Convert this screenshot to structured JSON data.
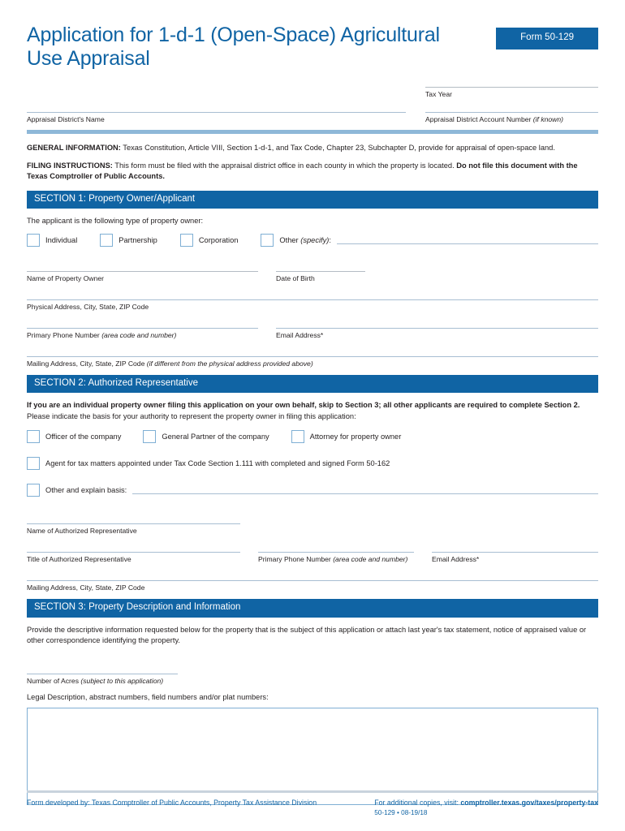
{
  "header": {
    "title": "Application for 1-d-1 (Open-Space) Agricultural Use Appraisal",
    "form_badge": "Form 50-129"
  },
  "top_fields": {
    "tax_year_label": "Tax Year",
    "appraisal_district_name_label": "Appraisal District's Name",
    "account_number_label": "Appraisal District Account Number ",
    "account_number_label_italic": "(if known)"
  },
  "intro": {
    "general_label": "GENERAL INFORMATION:",
    "general_text": " Texas Constitution, Article VIII, Section 1-d-1, and Tax Code, Chapter 23, Subchapter D, provide for appraisal of open-space land.",
    "filing_label": "FILING INSTRUCTIONS:",
    "filing_text": " This form must be filed with the appraisal district office in each county in which the property is located. ",
    "filing_bold_tail": "Do not file this document with the Texas Comptroller of Public Accounts."
  },
  "section1": {
    "bar": "SECTION 1: Property Owner/Applicant",
    "prompt": "The applicant is the following type of property owner:",
    "owner_types": [
      {
        "label": "Individual"
      },
      {
        "label": "Partnership"
      },
      {
        "label": "Corporation"
      }
    ],
    "other_label": "Other ",
    "other_label_italic": "(specify)",
    "other_label_tail": ":",
    "name_of_owner_label": "Name of Property Owner",
    "date_of_birth_label": "Date of Birth",
    "physical_address_label": "Physical Address, City, State, ZIP Code",
    "primary_phone_label": "Primary Phone Number ",
    "primary_phone_label_italic": "(area code and number)",
    "email_label": "Email Address*",
    "mailing_address_label": "Mailing Address, City, State, ZIP Code ",
    "mailing_address_label_italic": "(if different from the physical address provided above)"
  },
  "section2": {
    "bar": "SECTION 2: Authorized Representative",
    "bold_intro": "If you are an individual property owner filing this application on your own behalf, skip to Section 3; all other applicants are required to complete Section 2.",
    "sub_intro": "Please indicate the basis for your authority to represent the property owner in filing this application:",
    "basis_options": [
      {
        "label": "Officer of the company"
      },
      {
        "label": "General Partner of the company"
      },
      {
        "label": "Attorney for property owner"
      }
    ],
    "agent_option": "Agent for tax matters appointed under Tax Code Section 1.111 with completed and signed Form 50-162",
    "other_option": "Other and explain basis:",
    "name_label": "Name of Authorized Representative",
    "title_label": "Title of Authorized Representative",
    "primary_phone_label": "Primary Phone Number ",
    "primary_phone_label_italic": "(area code and number)",
    "email_label": "Email Address*",
    "mailing_address_label": "Mailing Address, City, State, ZIP Code"
  },
  "section3": {
    "bar": "SECTION 3: Property Description and Information",
    "intro": "Provide the descriptive information requested below for the property that is the subject of this application or attach last year's tax statement, notice of appraised value or other correspondence identifying the property.",
    "acres_label": "Number of Acres ",
    "acres_label_italic": "(subject to this application)",
    "legal_description_label": "Legal Description, abstract numbers, field numbers and/or plat numbers:"
  },
  "footer": {
    "developed_by": "Form developed by: Texas Comptroller of Public Accounts, Property Tax Assistance Division",
    "copies_prefix": "For additional copies, visit: ",
    "copies_url": "comptroller.texas.gov/taxes/property-tax",
    "revision": "50-129 • 08-19/18"
  }
}
